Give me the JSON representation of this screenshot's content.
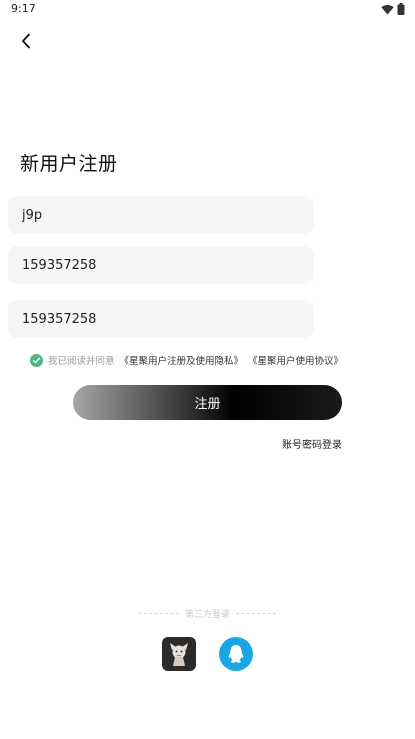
{
  "status_bar": {
    "time": "9:17"
  },
  "header": {
    "title": "新用户注册"
  },
  "form": {
    "username_value": "j9p",
    "phone_value": "159357258",
    "code_value": "159357258"
  },
  "agreement": {
    "prefix": "我已阅读并同意",
    "privacy_link": "《星聚用户注册及使用隐私》",
    "terms_link": "《星聚用户使用协议》",
    "checked": true,
    "check_color": "#4fb784"
  },
  "register_button": {
    "label": "注册"
  },
  "account_login_link": "账号密码登录",
  "third_party": {
    "label": "第三方登录",
    "providers": [
      {
        "name": "app-login",
        "icon": "app-logo-icon"
      },
      {
        "name": "qq-login",
        "icon": "qq-icon",
        "color": "#1aa6e4"
      }
    ]
  }
}
